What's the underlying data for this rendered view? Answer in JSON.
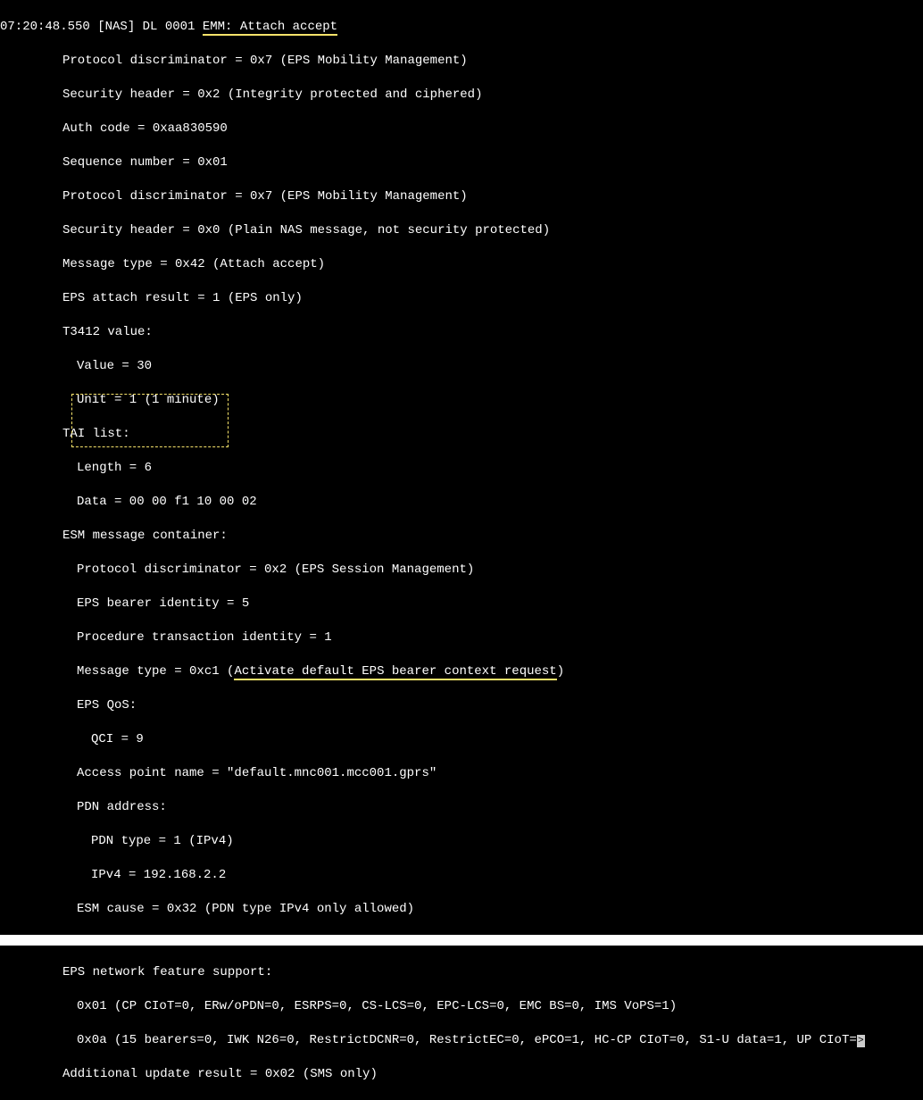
{
  "l0": "07:20:48.550 [NAS] DL 0001 ",
  "l0_u": "EMM: Attach accept",
  "l1": "Protocol discriminator = 0x7 (EPS Mobility Management)",
  "l2": "Security header = 0x2 (Integrity protected and ciphered)",
  "l3": "Auth code = 0xaa830590",
  "l4": "Sequence number = 0x01",
  "l5": "Protocol discriminator = 0x7 (EPS Mobility Management)",
  "l6": "Security header = 0x0 (Plain NAS message, not security protected)",
  "l7": "Message type = 0x42 (Attach accept)",
  "l8": "EPS attach result = 1 (EPS only)",
  "l9": "T3412 value:",
  "l10": "Value = 30",
  "l11": "Unit = 1 (1 minute)",
  "l12": "TAI list:",
  "l13": "Length = 6",
  "l14": "Data = 00 00 f1 10 00 02",
  "l15": "ESM message container:",
  "l16": "Protocol discriminator = 0x2 (EPS Session Management)",
  "l17": "EPS bearer identity = 5",
  "l18": "Procedure transaction identity = 1",
  "l19a": "Message type = 0xc1 (",
  "l19_u": "Activate default EPS bearer context request",
  "l19b": ")",
  "l20": "EPS QoS:",
  "l21": "QCI = 9",
  "l22": "Access point name = \"default.mnc001.mcc001.gprs\"",
  "l23": "PDN address:",
  "l24": "PDN type = 1 (IPv4)",
  "l25": "IPv4 = 192.168.2.2",
  "l26": "ESM cause = 0x32 (PDN type IPv4 only allowed)",
  "l27": "EPS network feature support:",
  "l28": "0x01 (CP CIoT=0, ERw/oPDN=0, ESRPS=0, CS-LCS=0, EPC-LCS=0, EMC BS=0, IMS VoPS=1)",
  "l29": "0x0a (15 bearers=0, IWK N26=0, RestrictDCNR=0, RestrictEC=0, ePCO=1, HC-CP CIoT=0, S1-U data=1, UP CIoT=",
  "l30": "Additional update result = 0x02 (SMS only)",
  "scroll_arrow": ">"
}
